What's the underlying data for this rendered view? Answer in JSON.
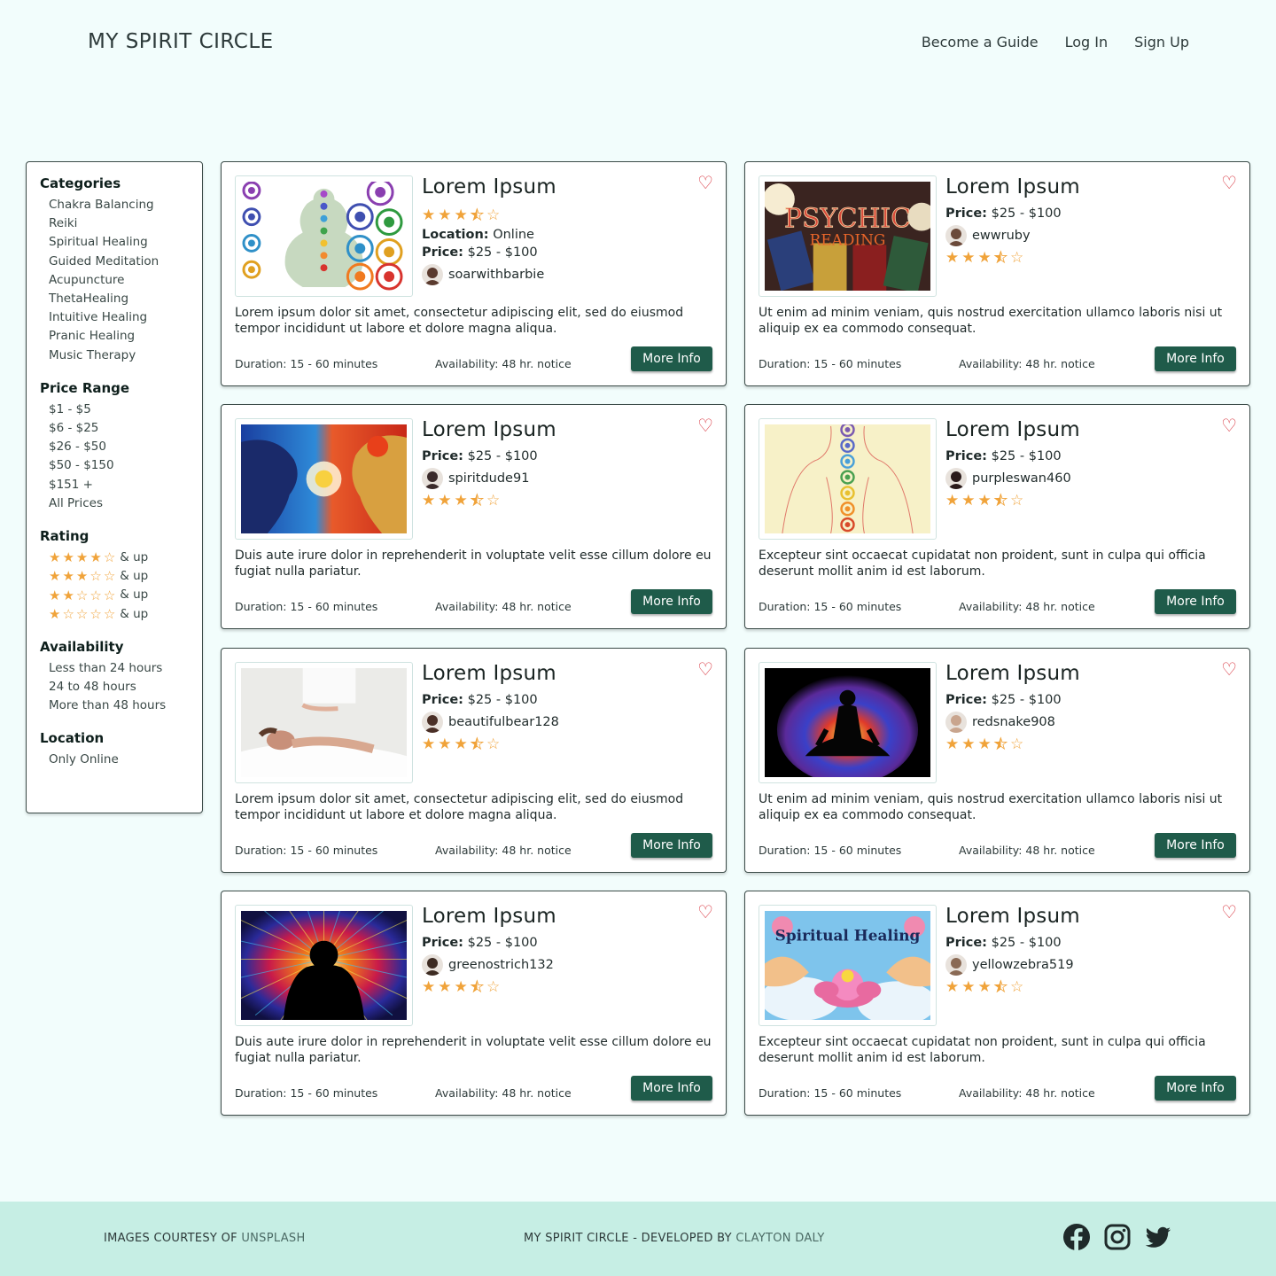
{
  "header": {
    "brand": "MY SPIRIT CIRCLE",
    "nav": [
      "Become a Guide",
      "Log In",
      "Sign Up"
    ]
  },
  "sidebar": {
    "categories_title": "Categories",
    "categories": [
      "Chakra Balancing",
      "Reiki",
      "Spiritual Healing",
      "Guided Meditation",
      "Acupuncture",
      "ThetaHealing",
      "Intuitive Healing",
      "Pranic Healing",
      "Music Therapy"
    ],
    "price_title": "Price Range",
    "prices": [
      "$1 - $5",
      "$6 - $25",
      "$26 - $50",
      "$50 - $150",
      "$151 +",
      "All Prices"
    ],
    "rating_title": "Rating",
    "ratings": [
      {
        "stars": 4,
        "label": "& up"
      },
      {
        "stars": 3,
        "label": "& up"
      },
      {
        "stars": 2,
        "label": "& up"
      },
      {
        "stars": 1,
        "label": "& up"
      }
    ],
    "availability_title": "Availability",
    "availability": [
      "Less than 24 hours",
      "24 to 48 hours",
      "More than 48 hours"
    ],
    "location_title": "Location",
    "location": [
      "Only Online"
    ]
  },
  "cards": [
    {
      "title": "Lorem Ipsum",
      "location_label": "Location:",
      "location": "Online",
      "price_label": "Price:",
      "price": "$25 - $100",
      "user": "soarwithbarbie",
      "rating": 3.5,
      "desc": "Lorem ipsum dolor sit amet, consectetur adipiscing elit, sed do eiusmod tempor incididunt ut labore et dolore magna aliqua.",
      "duration": "Duration: 15 - 60 minutes",
      "availability": "Availability: 48 hr. notice",
      "button": "More Info",
      "image": "chakra-icons",
      "avatar_color": "#5a3a2e"
    },
    {
      "title": "Lorem Ipsum",
      "price_label": "Price:",
      "price": "$25 - $100",
      "user": "ewwruby",
      "rating": 3.5,
      "desc": "Ut enim ad minim veniam, quis nostrud exercitation ullamco laboris nisi ut aliquip ex ea commodo consequat.",
      "duration": "Duration: 15 - 60 minutes",
      "availability": "Availability: 48 hr. notice",
      "button": "More Info",
      "image": "psychic-reading",
      "image_text_1": "PSYCHIC",
      "image_text_2": "READING",
      "avatar_color": "#6b4a3a"
    },
    {
      "title": "Lorem Ipsum",
      "price_label": "Price:",
      "price": "$25 - $100",
      "user": "spiritdude91",
      "rating": 3.5,
      "desc": "Duis aute irure dolor in reprehenderit in voluptate velit esse cillum dolore eu fugiat nulla pariatur.",
      "duration": "Duration: 15 - 60 minutes",
      "availability": "Availability: 48 hr. notice",
      "button": "More Info",
      "image": "cosmic-faces",
      "avatar_color": "#3a2a2a"
    },
    {
      "title": "Lorem Ipsum",
      "price_label": "Price:",
      "price": "$25 - $100",
      "user": "purpleswan460",
      "rating": 3.5,
      "desc": "Excepteur sint occaecat cupidatat non proident, sunt in culpa qui officia deserunt mollit anim id est laborum.",
      "duration": "Duration: 15 - 60 minutes",
      "availability": "Availability: 48 hr. notice",
      "button": "More Info",
      "image": "chakra-body",
      "avatar_color": "#2a1a1a"
    },
    {
      "title": "Lorem Ipsum",
      "price_label": "Price:",
      "price": "$25 - $100",
      "user": "beautifulbear128",
      "rating": 3.5,
      "desc": "Lorem ipsum dolor sit amet, consectetur adipiscing elit, sed do eiusmod tempor incididunt ut labore et dolore magna aliqua.",
      "duration": "Duration: 15 - 60 minutes",
      "availability": "Availability: 48 hr. notice",
      "button": "More Info",
      "image": "reiki-session",
      "avatar_color": "#4a2f26"
    },
    {
      "title": "Lorem Ipsum",
      "price_label": "Price:",
      "price": "$25 - $100",
      "user": "redsnake908",
      "rating": 3.5,
      "desc": "Ut enim ad minim veniam, quis nostrud exercitation ullamco laboris nisi ut aliquip ex ea commodo consequat.",
      "duration": "Duration: 15 - 60 minutes",
      "availability": "Availability: 48 hr. notice",
      "button": "More Info",
      "image": "meditation-aura",
      "avatar_color": "#c9a58e"
    },
    {
      "title": "Lorem Ipsum",
      "price_label": "Price:",
      "price": "$25 - $100",
      "user": "greenostrich132",
      "rating": 3.5,
      "desc": "Duis aute irure dolor in reprehenderit in voluptate velit esse cillum dolore eu fugiat nulla pariatur.",
      "duration": "Duration: 15 - 60 minutes",
      "availability": "Availability: 48 hr. notice",
      "button": "More Info",
      "image": "cosmic-silhouette",
      "avatar_color": "#3d2b22"
    },
    {
      "title": "Lorem Ipsum",
      "price_label": "Price:",
      "price": "$25 - $100",
      "user": "yellowzebra519",
      "rating": 3.5,
      "desc": "Excepteur sint occaecat cupidatat non proident, sunt in culpa qui officia deserunt mollit anim id est laborum.",
      "duration": "Duration: 15 - 60 minutes",
      "availability": "Availability: 48 hr. notice",
      "button": "More Info",
      "image": "spiritual-healing-lotus",
      "image_text_1": "Spiritual Healing",
      "avatar_color": "#8a6a55"
    }
  ],
  "footer": {
    "left_prefix": "IMAGES COURTESY OF ",
    "left_link": "UNSPLASH",
    "mid_prefix": "MY SPIRIT CIRCLE - DEVELOPED BY ",
    "mid_link": "CLAYTON DALY",
    "social": [
      "facebook-icon",
      "instagram-icon",
      "twitter-icon"
    ]
  },
  "colors": {
    "background": "#f2fdfc",
    "button": "#1f5b4a",
    "heart": "#d7303a",
    "star": "#f0a33a",
    "footer": "#c6eee4"
  }
}
